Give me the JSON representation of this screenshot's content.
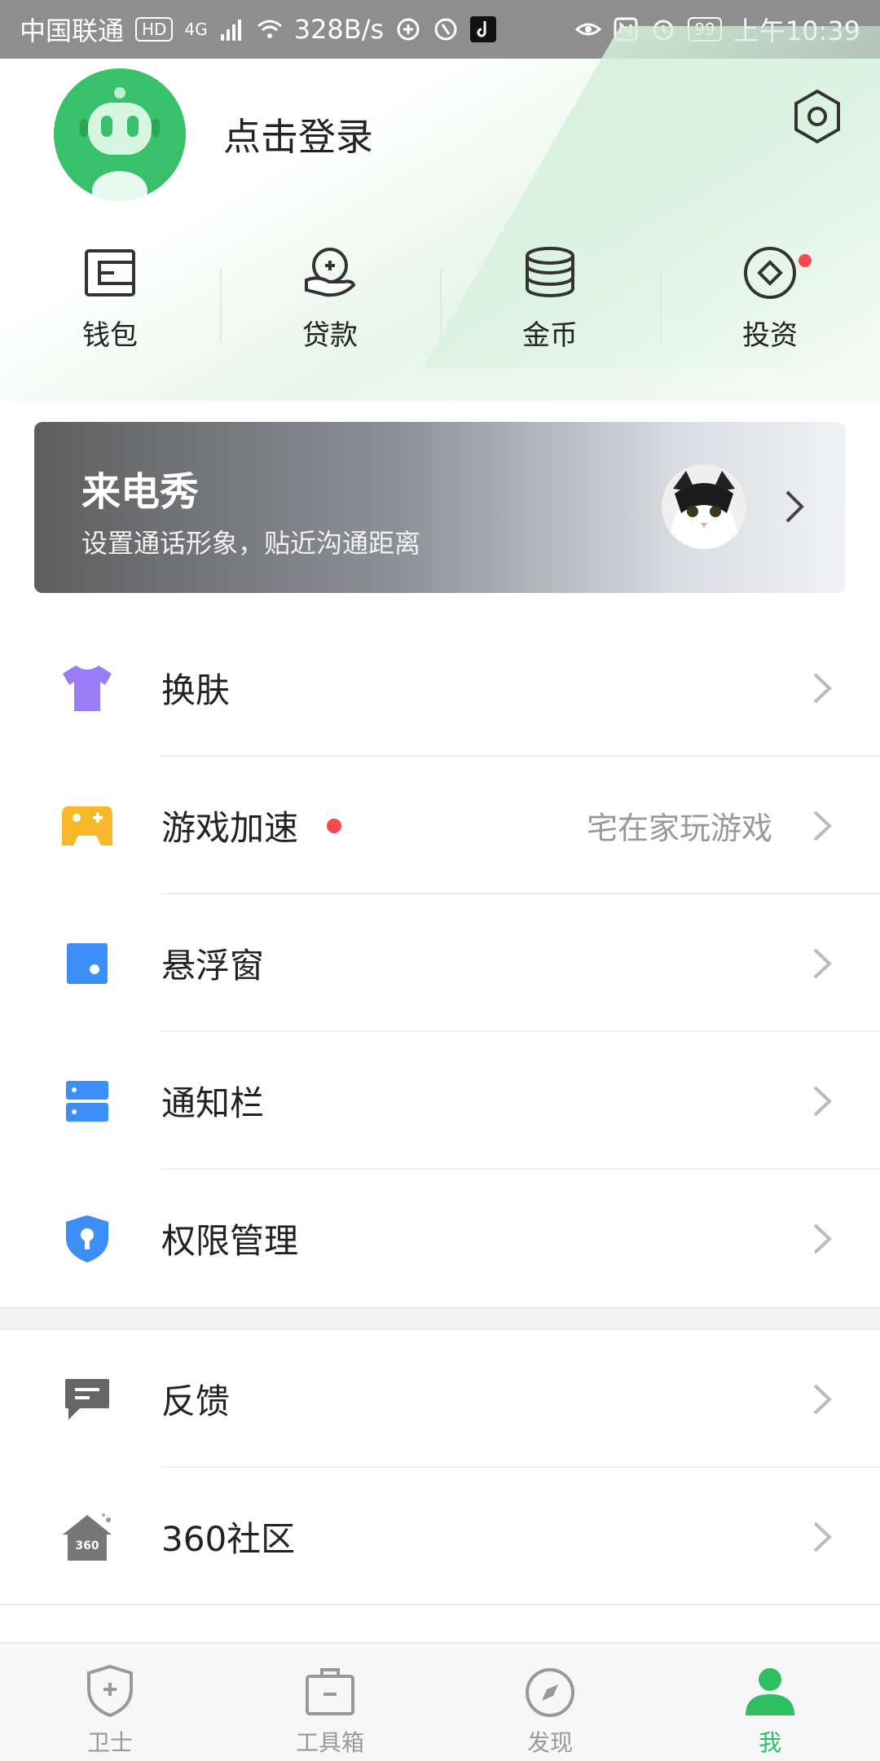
{
  "status_bar": {
    "carrier": "中国联通",
    "hd": "HD",
    "network": "4G",
    "speed": "328B/s",
    "battery": "99",
    "time": "上午10:39"
  },
  "header": {
    "login_text": "点击登录"
  },
  "quick_actions": [
    {
      "label": "钱包"
    },
    {
      "label": "贷款"
    },
    {
      "label": "金币"
    },
    {
      "label": "投资"
    }
  ],
  "banner": {
    "title": "来电秀",
    "subtitle": "设置通话形象，贴近沟通距离"
  },
  "menu": [
    {
      "label": "换肤",
      "extra": "",
      "color": "#9a7cf7"
    },
    {
      "label": "游戏加速",
      "extra": "宅在家玩游戏",
      "color": "#f7b82a"
    },
    {
      "label": "悬浮窗",
      "extra": "",
      "color": "#3e8ef7"
    },
    {
      "label": "通知栏",
      "extra": "",
      "color": "#3e8ef7"
    },
    {
      "label": "权限管理",
      "extra": "",
      "color": "#3e8ef7"
    }
  ],
  "menu2": [
    {
      "label": "反馈",
      "extra": "",
      "color": "#666666"
    },
    {
      "label": "360社区",
      "extra": "",
      "color": "#666666"
    }
  ],
  "community_badge": "360",
  "bottom_nav": [
    {
      "label": "卫士"
    },
    {
      "label": "工具箱"
    },
    {
      "label": "发现"
    },
    {
      "label": "我"
    }
  ],
  "colors": {
    "accent": "#2fbf62",
    "red_dot": "#f24c4c"
  }
}
